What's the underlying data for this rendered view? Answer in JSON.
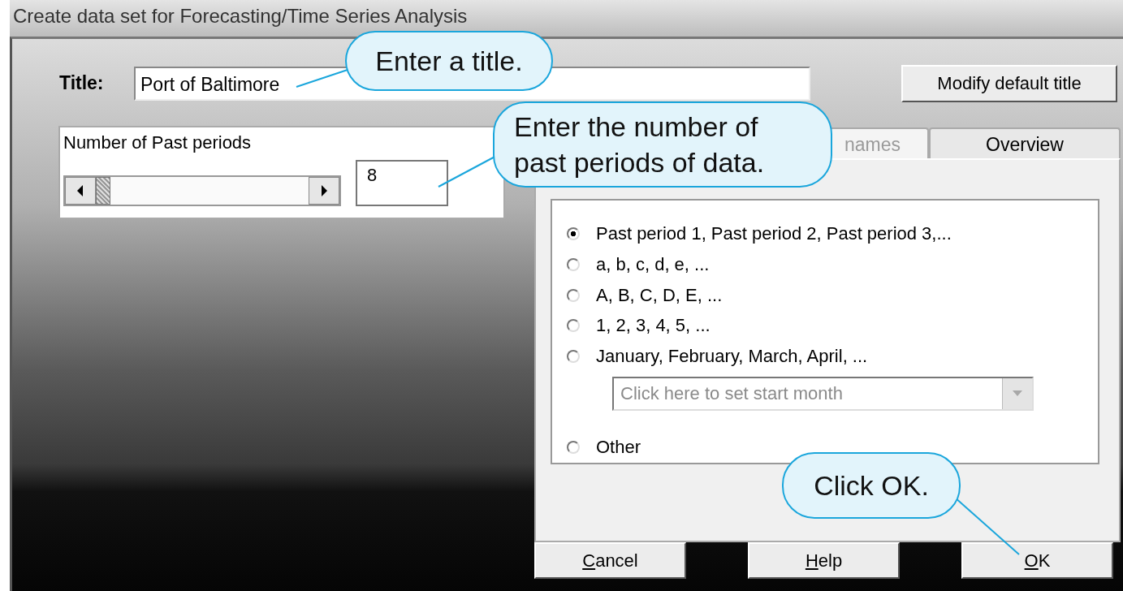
{
  "window": {
    "title": "Create data set for Forecasting/Time Series Analysis"
  },
  "title_row": {
    "label": "Title:",
    "value": "Port of Baltimore",
    "button": "Modify default title"
  },
  "periods": {
    "label": "Number of Past periods",
    "value": "8"
  },
  "tabs": [
    {
      "label": "names",
      "selected": true
    },
    {
      "label": "Overview",
      "selected": false
    }
  ],
  "naming_options": [
    {
      "kind": "radio",
      "label": "Past period 1, Past period 2, Past period 3,...",
      "selected": true
    },
    {
      "kind": "radio",
      "label": "a, b, c, d, e, ...",
      "selected": false
    },
    {
      "kind": "radio",
      "label": "A, B, C, D, E, ...",
      "selected": false
    },
    {
      "kind": "radio",
      "label": "1, 2, 3, 4, 5, ...",
      "selected": false
    },
    {
      "kind": "radio",
      "label": "January, February, March, April, ...",
      "selected": false
    },
    {
      "kind": "dropdown",
      "placeholder": "Click here to set start month",
      "disabled": true
    },
    {
      "kind": "radio",
      "label": "Other",
      "selected": false
    }
  ],
  "buttons": [
    "Cancel",
    "Help",
    "OK"
  ],
  "callouts": [
    "Enter a title.",
    "Enter the number of past periods of data.",
    "Click OK."
  ]
}
